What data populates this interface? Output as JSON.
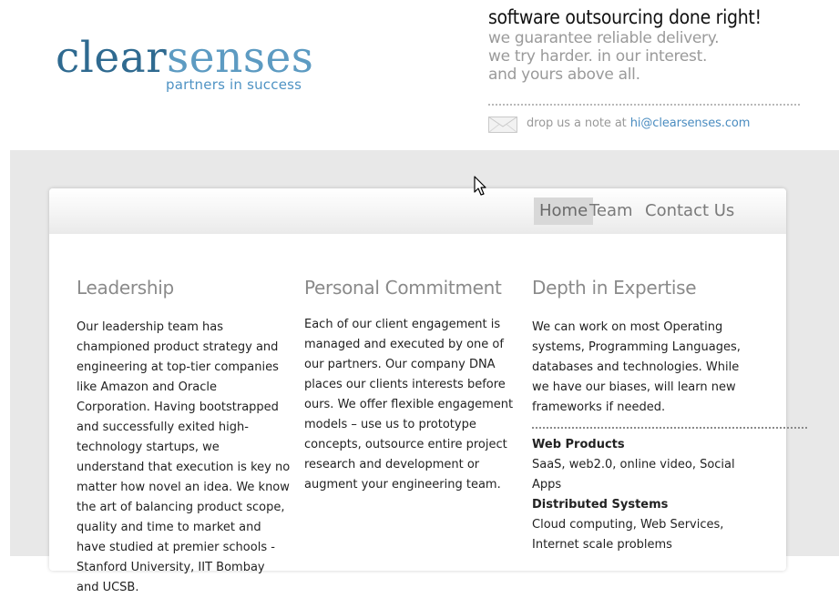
{
  "logo": {
    "part1": "clear",
    "part2": "senses",
    "tagline": "partners in success"
  },
  "header": {
    "title": "software outsourcing done right!",
    "lines": [
      "we guarantee reliable delivery.",
      "we try harder. in our interest.",
      "and yours above all."
    ],
    "mail_prefix": "drop us a note at ",
    "mail_link": "hi@clearsenses.com",
    "mail_icon": "envelope-icon"
  },
  "nav": {
    "items": [
      {
        "label": "Home",
        "active": true
      },
      {
        "label": "Team",
        "active": false
      },
      {
        "label": "Contact Us",
        "active": false
      }
    ]
  },
  "columns": [
    {
      "title": "Leadership",
      "body": "Our leadership team has championed product strategy and engineering at top-tier companies like Amazon and Oracle Corporation. Having bootstrapped and successfully exited high-technology startups, we understand that execution is key no matter how novel an idea. We know the art of balancing product scope, quality and time to market and have studied at premier schools - Stanford University, IIT Bombay and UCSB."
    },
    {
      "title": "Personal Commitment",
      "body": "Each of our client engagement is managed and executed by one of our partners. Our company DNA places our clients interests before ours. We offer flexible engagement models – use us to prototype concepts, outsource entire project research and development or augment your engineering team."
    },
    {
      "title": "Depth in Expertise",
      "body": "We can work on most Operating systems, Programming Languages, databases and technologies. While we have our biases, will learn new frameworks if needed.",
      "features": [
        {
          "title": "Web Products",
          "body": "SaaS, web2.0, online video, Social Apps"
        },
        {
          "title": "Distributed Systems",
          "body": "Cloud computing, Web Services, Internet scale problems"
        }
      ]
    }
  ]
}
